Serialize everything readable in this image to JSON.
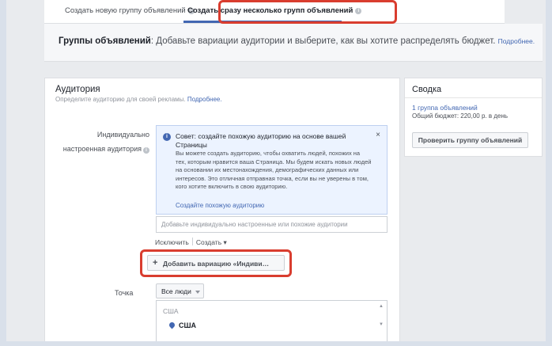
{
  "tabs": {
    "single_label": "Создать новую группу объявлений",
    "multiple_label": "Создать сразу несколько групп объявлений"
  },
  "groups_bar": {
    "title": "Группы объявлений",
    "text": ": Добавьте вариации аудитории и выберите, как вы хотите распределять бюджет.",
    "more": "Подробнее."
  },
  "audience": {
    "title": "Аудитория",
    "subtitle": "Определите аудиторию для своей рекламы.",
    "more": "Подробнее.",
    "custom_label_1": "Индивидуально",
    "custom_label_2": "настроенная аудитория",
    "tip": {
      "title": "Совет: создайте похожую аудиторию на основе вашей Страницы",
      "body": "Вы можете создать аудиторию, чтобы охватить людей, похожих на тех, которым нравится ваша Страница. Мы будем искать новых людей на основании их местонахождения, демографических данных или интересов. Это отличная отправная точка, если вы не уверены в том, кого хотите включить в свою аудиторию.",
      "link": "Создайте похожую аудиторию",
      "close": "×"
    },
    "custom_placeholder": "Добавьте индивидуально настроенные или похожие аудитории",
    "exclude": "Исключить",
    "create": "Создать",
    "add_variation": "Добавить вариацию «Индиви…",
    "location_label": "Точка",
    "location_select": "Все люди",
    "location_country": "США",
    "location_item": "США"
  },
  "summary": {
    "title": "Сводка",
    "groups": "1 группа объявлений",
    "budget": "Общий бюджет: 220,00 р. в день",
    "check_button": "Проверить группу объявлений"
  },
  "colors": {
    "accent": "#4267b2",
    "highlight": "#d93d2f",
    "page_bg": "#e9ebee"
  }
}
